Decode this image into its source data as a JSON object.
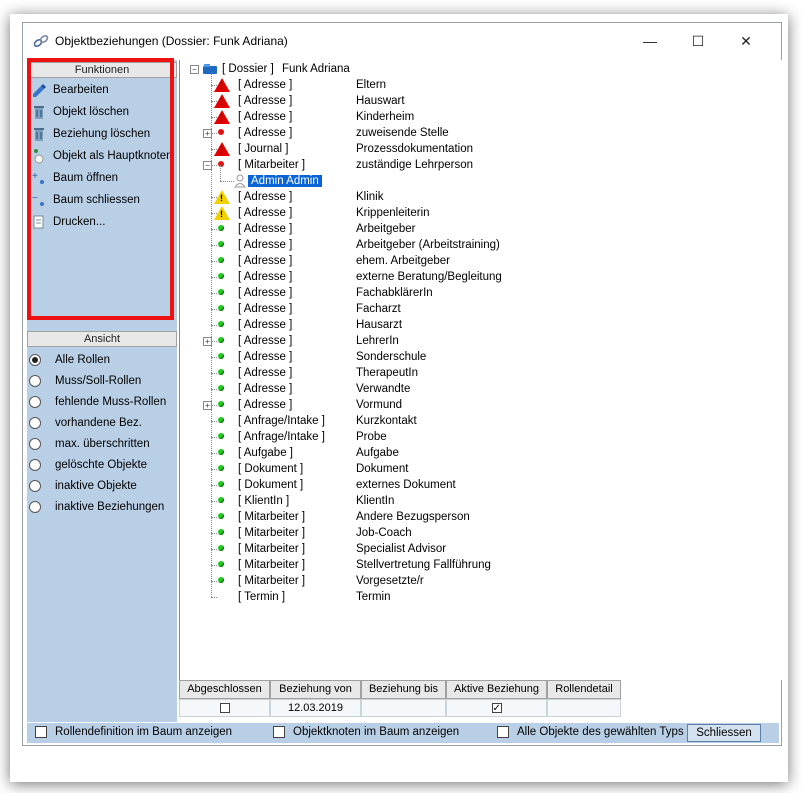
{
  "window": {
    "title": "Objektbeziehungen (Dossier: Funk Adriana)",
    "minimize": "—",
    "maximize": "☐",
    "close": "✕"
  },
  "functions": {
    "header": "Funktionen",
    "items": [
      {
        "label": "Bearbeiten",
        "icon": "pencil-icon"
      },
      {
        "label": "Objekt löschen",
        "icon": "trash-icon"
      },
      {
        "label": "Beziehung löschen",
        "icon": "trash-icon"
      },
      {
        "label": "Objekt als Hauptknoten",
        "icon": "node-icon"
      },
      {
        "label": "Baum öffnen",
        "icon": "tree-open-icon"
      },
      {
        "label": "Baum schliessen",
        "icon": "tree-close-icon"
      },
      {
        "label": "Drucken...",
        "icon": "print-icon"
      }
    ]
  },
  "view": {
    "header": "Ansicht",
    "options": [
      {
        "label": "Alle Rollen",
        "selected": true
      },
      {
        "label": "Muss/Soll-Rollen",
        "selected": false
      },
      {
        "label": "fehlende Muss-Rollen",
        "selected": false
      },
      {
        "label": "vorhandene Bez.",
        "selected": false
      },
      {
        "label": "max. überschritten",
        "selected": false
      },
      {
        "label": "gelöschte Objekte",
        "selected": false
      },
      {
        "label": "inaktive Objekte",
        "selected": false
      },
      {
        "label": "inaktive Beziehungen",
        "selected": false
      }
    ]
  },
  "tree": {
    "root": {
      "type": "[ Dossier ]",
      "name": "Funk Adriana"
    },
    "nodes": [
      {
        "type": "[ Adresse ]",
        "name": "Eltern",
        "status": "error",
        "expander": false
      },
      {
        "type": "[ Adresse ]",
        "name": "Hauswart",
        "status": "error",
        "expander": false
      },
      {
        "type": "[ Adresse ]",
        "name": "Kinderheim",
        "status": "error",
        "expander": false
      },
      {
        "type": "[ Adresse ]",
        "name": "zuweisende Stelle",
        "status": "red",
        "expander": "+"
      },
      {
        "type": "[ Journal ]",
        "name": "Prozessdokumentation",
        "status": "error",
        "expander": false
      },
      {
        "type": "[ Mitarbeiter ]",
        "name": "zuständige Lehrperson",
        "status": "red",
        "expander": "−"
      },
      {
        "type": "",
        "name": "Admin Admin",
        "status": "child",
        "expander": false
      },
      {
        "type": "[ Adresse ]",
        "name": "Klinik",
        "status": "warning",
        "expander": false
      },
      {
        "type": "[ Adresse ]",
        "name": "Krippenleiterin",
        "status": "warning",
        "expander": false
      },
      {
        "type": "[ Adresse ]",
        "name": "Arbeitgeber",
        "status": "green",
        "expander": false
      },
      {
        "type": "[ Adresse ]",
        "name": "Arbeitgeber (Arbeitstraining)",
        "status": "green",
        "expander": false
      },
      {
        "type": "[ Adresse ]",
        "name": "ehem. Arbeitgeber",
        "status": "green",
        "expander": false
      },
      {
        "type": "[ Adresse ]",
        "name": "externe Beratung/Begleitung",
        "status": "green",
        "expander": false
      },
      {
        "type": "[ Adresse ]",
        "name": "FachabklärerIn",
        "status": "green",
        "expander": false
      },
      {
        "type": "[ Adresse ]",
        "name": "Facharzt",
        "status": "green",
        "expander": false
      },
      {
        "type": "[ Adresse ]",
        "name": "Hausarzt",
        "status": "green",
        "expander": false
      },
      {
        "type": "[ Adresse ]",
        "name": "LehrerIn",
        "status": "green",
        "expander": "+"
      },
      {
        "type": "[ Adresse ]",
        "name": "Sonderschule",
        "status": "green",
        "expander": false
      },
      {
        "type": "[ Adresse ]",
        "name": "TherapeutIn",
        "status": "green",
        "expander": false
      },
      {
        "type": "[ Adresse ]",
        "name": "Verwandte",
        "status": "green",
        "expander": false
      },
      {
        "type": "[ Adresse ]",
        "name": "Vormund",
        "status": "green",
        "expander": "+"
      },
      {
        "type": "[ Anfrage/Intake ]",
        "name": "Kurzkontakt",
        "status": "green",
        "expander": false
      },
      {
        "type": "[ Anfrage/Intake ]",
        "name": "Probe",
        "status": "green",
        "expander": false
      },
      {
        "type": "[ Aufgabe ]",
        "name": "Aufgabe",
        "status": "green",
        "expander": false
      },
      {
        "type": "[ Dokument ]",
        "name": "Dokument",
        "status": "green",
        "expander": false
      },
      {
        "type": "[ Dokument ]",
        "name": "externes Dokument",
        "status": "green",
        "expander": false
      },
      {
        "type": "[ KlientIn ]",
        "name": "KlientIn",
        "status": "green",
        "expander": false
      },
      {
        "type": "[ Mitarbeiter ]",
        "name": "Andere Bezugsperson",
        "status": "green",
        "expander": false
      },
      {
        "type": "[ Mitarbeiter ]",
        "name": "Job-Coach",
        "status": "green",
        "expander": false
      },
      {
        "type": "[ Mitarbeiter ]",
        "name": "Specialist Advisor",
        "status": "green",
        "expander": false
      },
      {
        "type": "[ Mitarbeiter ]",
        "name": "Stellvertretung Fallführung",
        "status": "green",
        "expander": false
      },
      {
        "type": "[ Mitarbeiter ]",
        "name": "Vorgesetzte/r",
        "status": "green",
        "expander": false
      },
      {
        "type": "[ Termin ]",
        "name": "Termin",
        "status": "none",
        "expander": false
      }
    ]
  },
  "grid": {
    "columns": [
      "Abgeschlossen",
      "Beziehung von",
      "Beziehung bis",
      "Aktive Beziehung",
      "Rollendetail"
    ],
    "row": {
      "abgeschlossen": false,
      "von": "12.03.2019",
      "bis": "",
      "aktiv": true,
      "rollendetail": ""
    }
  },
  "footer": {
    "opt1": "Rollendefinition im Baum anzeigen",
    "opt2": "Objektknoten im Baum anzeigen",
    "opt3": "Alle Objekte des gewählten Typs",
    "close_label": "Schliessen"
  }
}
